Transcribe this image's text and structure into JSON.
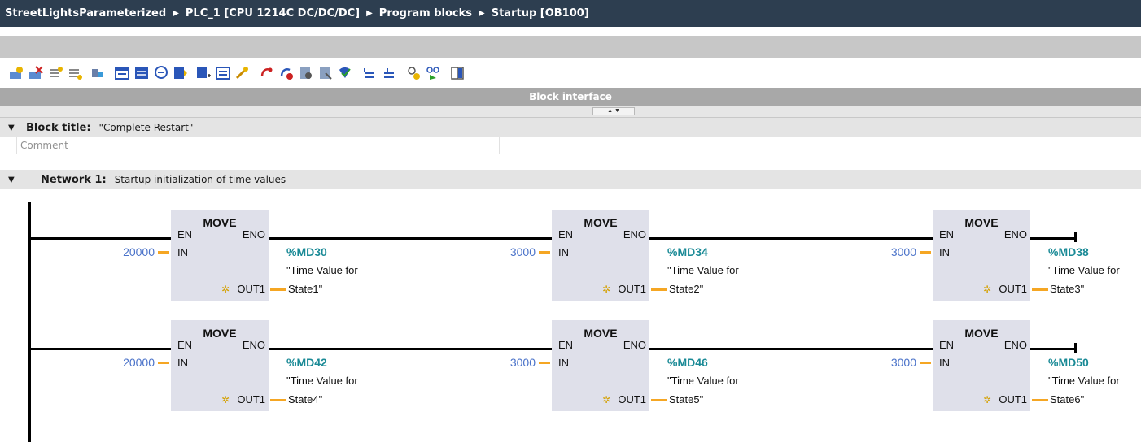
{
  "breadcrumb": [
    "StreetLightsParameterized",
    "PLC_1 [CPU 1214C DC/DC/DC]",
    "Program blocks",
    "Startup [OB100]"
  ],
  "panel": {
    "title": "Block interface"
  },
  "block": {
    "title_label": "Block title:",
    "title_value": "\"Complete Restart\"",
    "comment_placeholder": "Comment"
  },
  "network": {
    "label": "Network 1:",
    "title": "Startup initialization of time values"
  },
  "pins": {
    "en": "EN",
    "eno": "ENO",
    "in": "IN",
    "out": "OUT1"
  },
  "rungs": [
    [
      {
        "name": "MOVE",
        "in": "20000",
        "address": "%MD30",
        "tag_line1": "\"Time Value for",
        "tag_line2": "State1\""
      },
      {
        "name": "MOVE",
        "in": "3000",
        "address": "%MD34",
        "tag_line1": "\"Time Value for",
        "tag_line2": "State2\""
      },
      {
        "name": "MOVE",
        "in": "3000",
        "address": "%MD38",
        "tag_line1": "\"Time Value for",
        "tag_line2": "State3\""
      }
    ],
    [
      {
        "name": "MOVE",
        "in": "20000",
        "address": "%MD42",
        "tag_line1": "\"Time Value for",
        "tag_line2": "State4\""
      },
      {
        "name": "MOVE",
        "in": "3000",
        "address": "%MD46",
        "tag_line1": "\"Time Value for",
        "tag_line2": "State5\""
      },
      {
        "name": "MOVE",
        "in": "3000",
        "address": "%MD50",
        "tag_line1": "\"Time Value for",
        "tag_line2": "State6\""
      }
    ]
  ],
  "colors": {
    "wire": "#000000",
    "pin": "#f5a623",
    "box": "#dfe0ea",
    "literal": "#4a72c9",
    "address": "#1a8a96",
    "titlebar": "#2d3e50"
  },
  "toolbar_icons": [
    "insert-network-icon",
    "delete-network-icon",
    "insert-row-icon",
    "append-row-icon",
    "absolute-operand-icon",
    "favorites-icon",
    "open-all-networks-icon",
    "close-all-networks-icon",
    "network-comments-icon",
    "symbolic-operand-icon",
    "tag-info-icon",
    "navigate-icon",
    "gear-icon",
    "go-to-error-icon",
    "previous-error-icon",
    "call-structure-icon",
    "update-calls-icon",
    "consistency-check-icon",
    "indent-icon",
    "outdent-icon",
    "monitoring-icon",
    "glasses-icon",
    "split-editor-icon"
  ]
}
